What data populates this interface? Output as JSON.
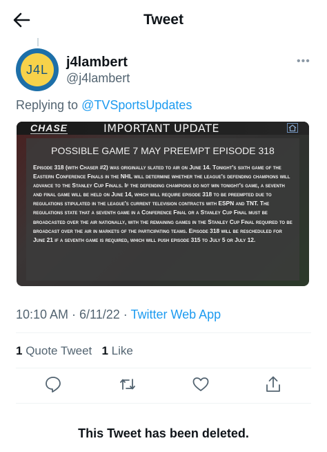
{
  "header": {
    "title": "Tweet",
    "back_icon": "arrow-left-icon"
  },
  "author": {
    "avatar_text": "J4L",
    "name": "j4lambert",
    "handle": "@j4lambert"
  },
  "reply": {
    "prefix": "Replying to ",
    "target": "@TVSportsUpdates"
  },
  "card": {
    "logo": "CHASE",
    "banner_title": "IMPORTANT UPDATE",
    "heading": "POSSIBLE GAME 7 MAY PREEMPT EPISODE 318",
    "body": "Episode 318 (with Chaser #2) was originally slated to air on June 14. Tonight's sixth game of the Eastern Conference Finals in the NHL will determine whether the league's defending champions will advance to the Stanley Cup Finals. If the defending champions do not win tonight's game, a seventh and final game will be held on June 14, which will require episode 318 to be preempted due to regulations stipulated in the league's current television contracts with ESPN and TNT. The regulations state that a seventh game in a Conference Final or a Stanley Cup Final must be broadcasted over the air nationally, with the remaining games in the Stanley Cup Final required to be broadcast over the air in markets of the participating teams. Episode 318 will be rescheduled for June 21 if a seventh game is required, which will push episode 315 to July 5 or July 12."
  },
  "meta": {
    "time": "10:10 AM · 6/11/22 · ",
    "source": "Twitter Web App"
  },
  "stats": {
    "quote_count": "1",
    "quote_label": "Quote Tweet",
    "like_count": "1",
    "like_label": "Like"
  },
  "actions": [
    "reply-icon",
    "retweet-icon",
    "like-icon",
    "share-icon"
  ],
  "deleted_notice": "This Tweet has been deleted."
}
